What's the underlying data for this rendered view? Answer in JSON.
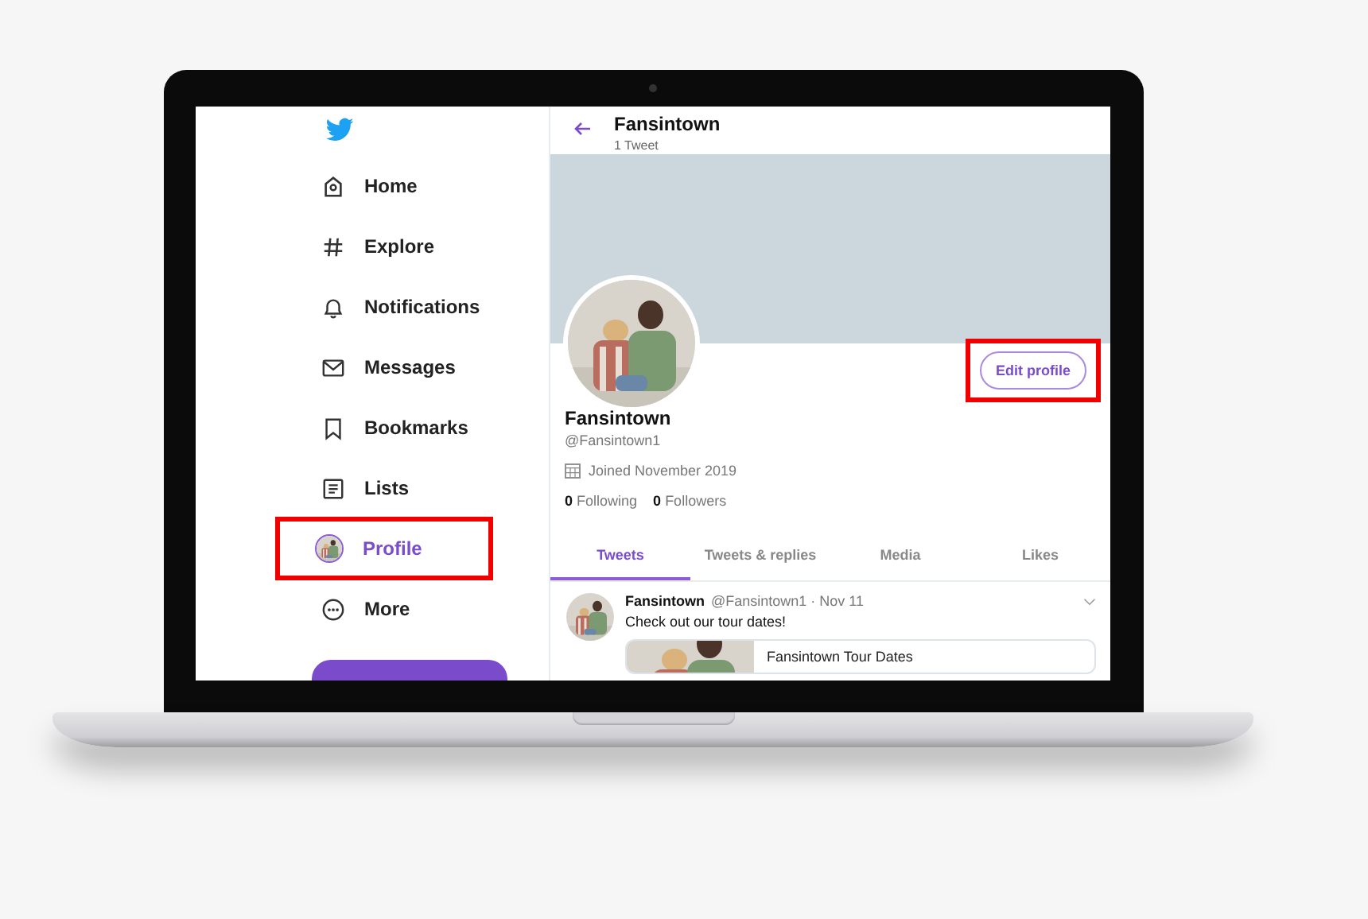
{
  "sidebar": {
    "items": [
      {
        "label": "Home",
        "selected": false,
        "highlighted": false
      },
      {
        "label": "Explore",
        "selected": false,
        "highlighted": false
      },
      {
        "label": "Notifications",
        "selected": false,
        "highlighted": false
      },
      {
        "label": "Messages",
        "selected": false,
        "highlighted": false
      },
      {
        "label": "Bookmarks",
        "selected": false,
        "highlighted": false
      },
      {
        "label": "Lists",
        "selected": false,
        "highlighted": false
      },
      {
        "label": "Profile",
        "selected": true,
        "highlighted": true
      },
      {
        "label": "More",
        "selected": false,
        "highlighted": false
      }
    ]
  },
  "header": {
    "title": "Fansintown",
    "subtitle": "1 Tweet"
  },
  "profile": {
    "name": "Fansintown",
    "handle": "@Fansintown1",
    "joined": "Joined November 2019",
    "following_count": "0",
    "following_label": "Following",
    "followers_count": "0",
    "followers_label": "Followers",
    "edit_button": {
      "label": "Edit profile",
      "highlighted": true
    }
  },
  "tabs": [
    {
      "label": "Tweets",
      "selected": true
    },
    {
      "label": "Tweets & replies",
      "selected": false
    },
    {
      "label": "Media",
      "selected": false
    },
    {
      "label": "Likes",
      "selected": false
    }
  ],
  "tweet": {
    "author": "Fansintown",
    "meta": "@Fansintown1 · Nov 11",
    "text": "Check out our tour dates!",
    "card_title": "Fansintown Tour Dates"
  }
}
